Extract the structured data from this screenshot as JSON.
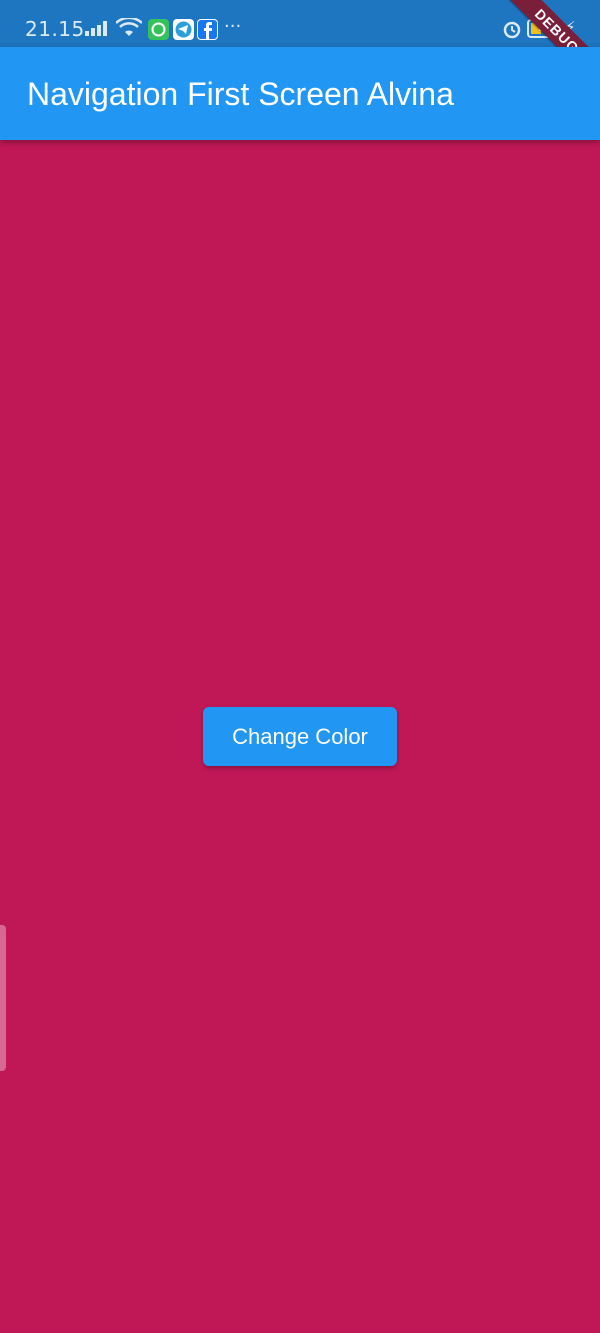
{
  "status_bar": {
    "time": "21.15",
    "more": "···",
    "battery_level": "5",
    "icons": [
      "signal-icon",
      "wifi-icon",
      "whatsapp-icon",
      "telegram-icon",
      "facebook-icon",
      "alarm-icon",
      "battery-icon",
      "charging-icon"
    ]
  },
  "debug_banner": {
    "label": "DEBUG"
  },
  "app_bar": {
    "title": "Navigation First Screen Alvina",
    "color": "#2196f3"
  },
  "content": {
    "background": "#c01857"
  },
  "button": {
    "label": "Change Color",
    "color": "#2196f3"
  }
}
